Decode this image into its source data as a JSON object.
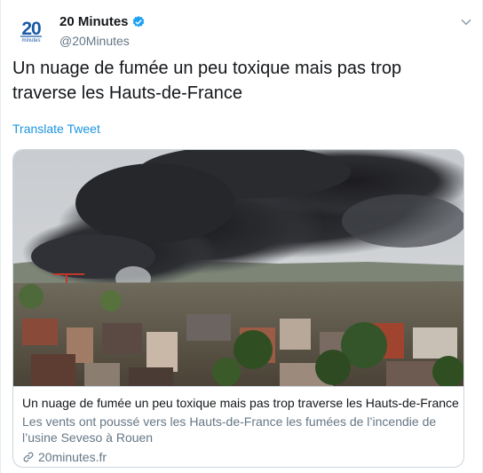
{
  "author": {
    "name": "20 Minutes",
    "handle": "@20Minutes",
    "avatar_logo_text": "20",
    "avatar_logo_subtext": "minutes",
    "verified": true
  },
  "tweet": {
    "text": "Un nuage de fumée un peu toxique mais pas trop traverse les Hauts-de-France",
    "translate_label": "Translate Tweet"
  },
  "card": {
    "title": "Un nuage de fumée un peu toxique mais pas trop traverse les Hauts-de-France",
    "description": "Les vents ont poussé vers les Hauts-de-France les fumées de l’incendie de l’usine Seveso à Rouen",
    "domain": "20minutes.fr",
    "image_subject": "photo-smoke-plume-over-town"
  },
  "colors": {
    "link_blue": "#1b95e0",
    "verified_blue": "#1da1f2",
    "logo_blue": "#1a5aa6",
    "text_primary": "#14171a",
    "text_secondary": "#657786",
    "border": "#ccd6dd"
  },
  "icons": {
    "verified": "verified-badge-icon",
    "caret": "chevron-down-icon",
    "link": "link-icon"
  }
}
